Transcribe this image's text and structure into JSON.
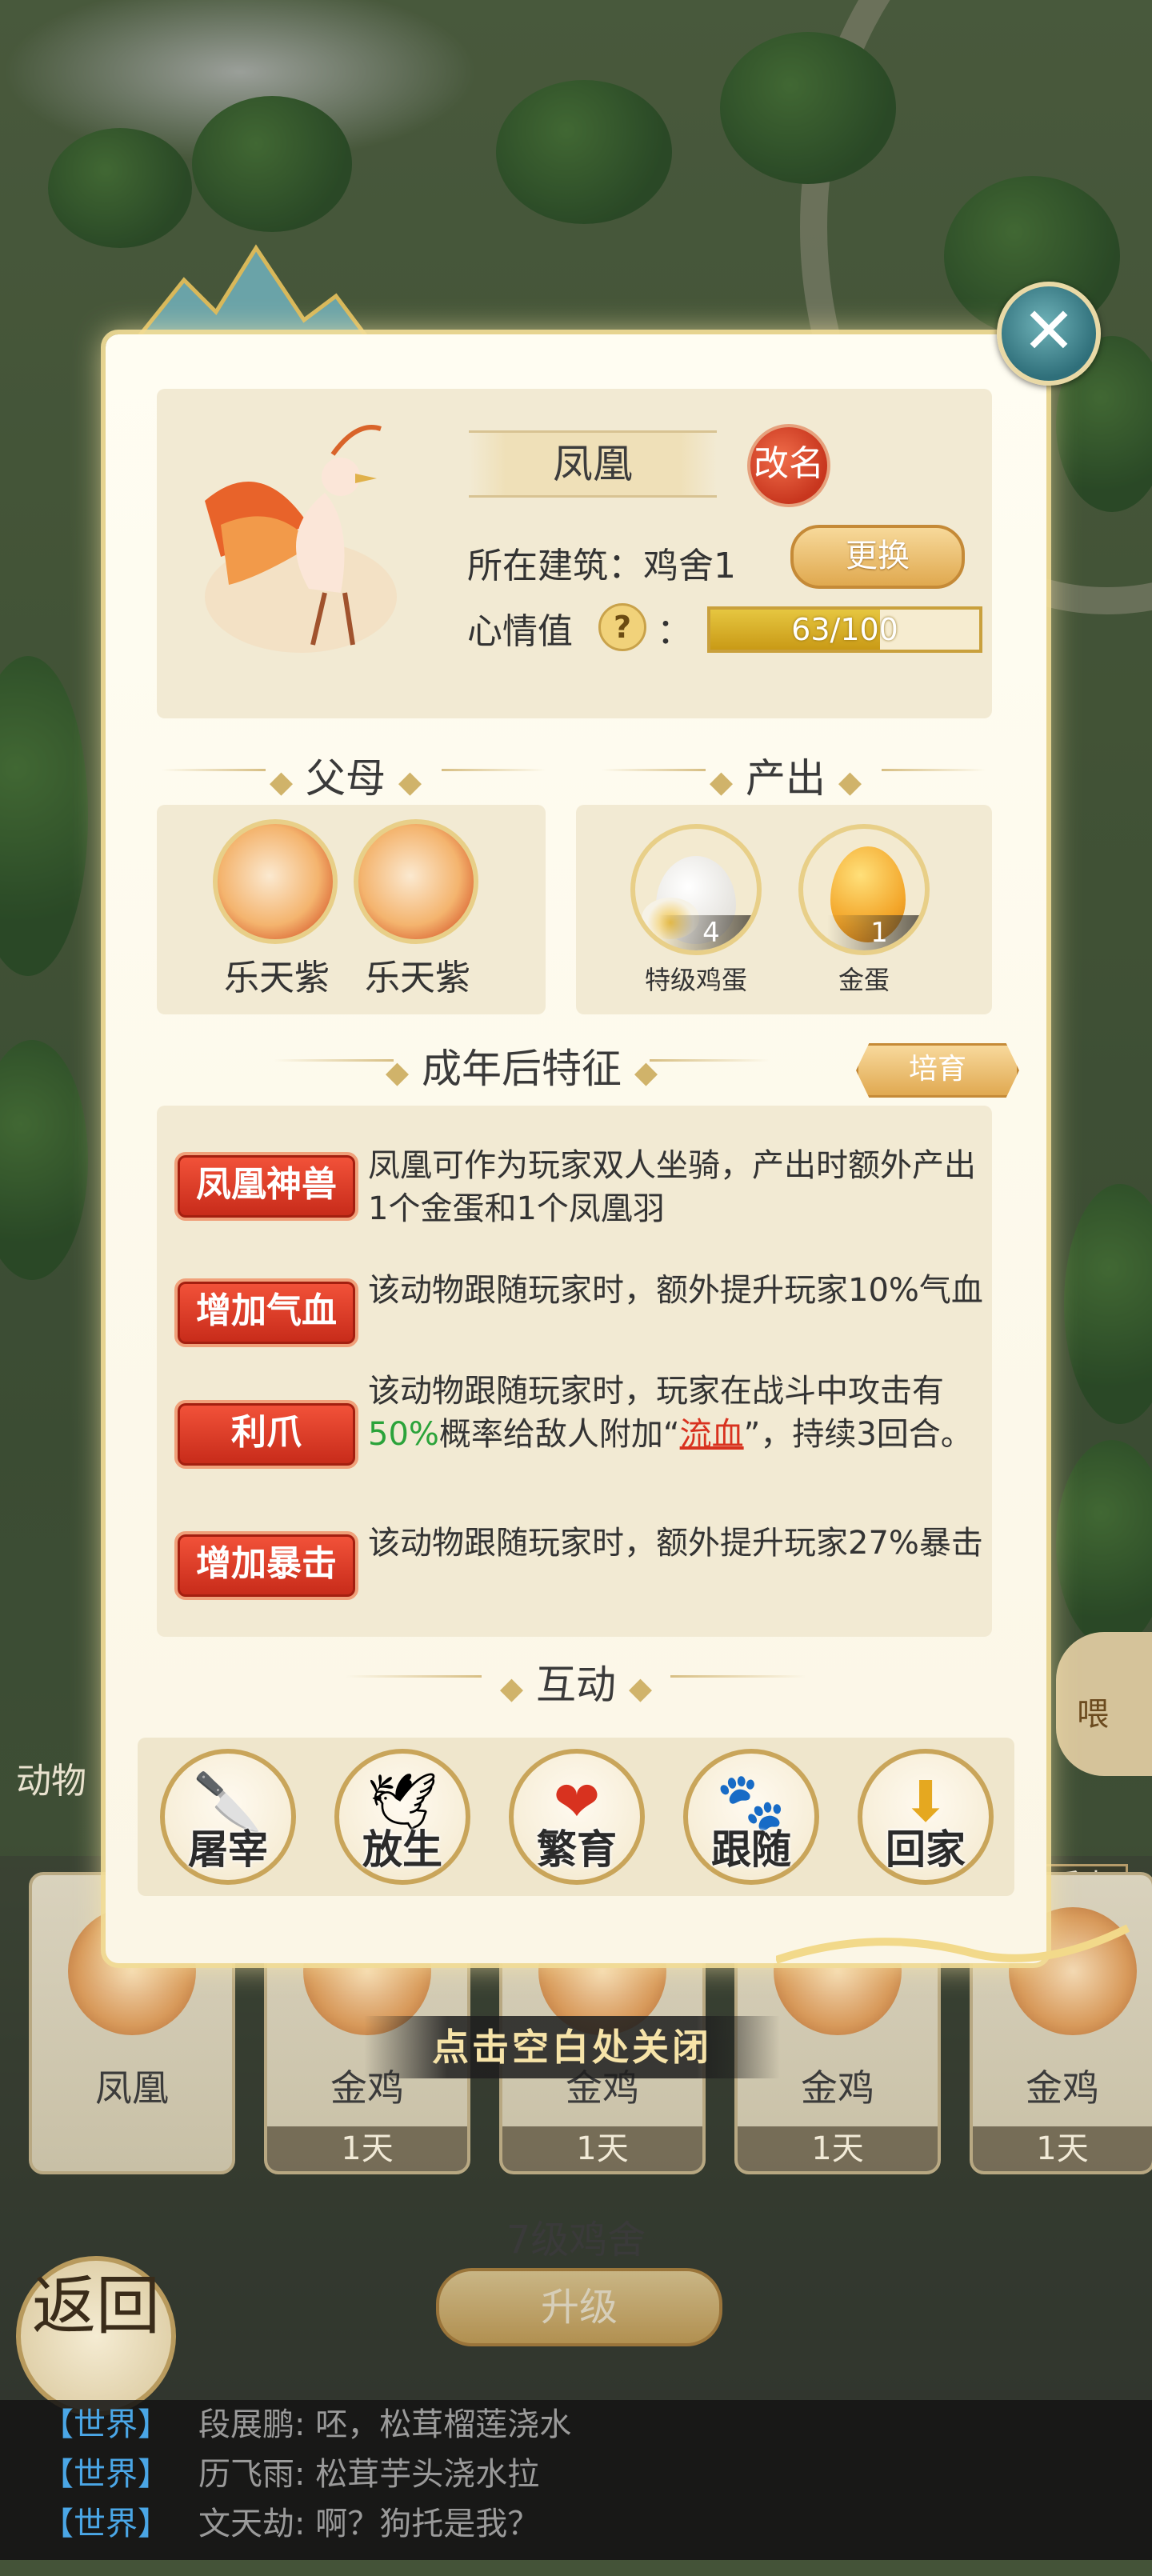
{
  "background": {
    "animal_tab": "动物",
    "feed_button": "喂",
    "pen_status": "系中",
    "animal_cards": [
      {
        "name": "凤凰",
        "time": ""
      },
      {
        "name": "金鸡",
        "time": "1天"
      },
      {
        "name": "金鸡",
        "time": "1天"
      },
      {
        "name": "金鸡",
        "time": "1天"
      },
      {
        "name": "金鸡",
        "time": "1天"
      }
    ],
    "close_hint": "点击空白处关闭",
    "coop_level": "7级鸡舍",
    "upgrade_label": "升级",
    "back_label": "返回"
  },
  "chat": [
    {
      "channel": "【世界】",
      "user": "段展鹏",
      "message": "呸，松茸榴莲浇水"
    },
    {
      "channel": "【世界】",
      "user": "历飞雨",
      "message": "松茸芋头浇水拉"
    },
    {
      "channel": "【世界】",
      "user": "文天劫",
      "message": "啊？狗托是我？"
    }
  ],
  "pet": {
    "name": "凤凰",
    "rename_label": "改名",
    "building_label": "所在建筑：鸡舍1",
    "change_label": "更换",
    "mood_label": "心情值",
    "mood_help": "?",
    "mood_colon": "：",
    "mood_text": "63/100",
    "mood_value": 63,
    "mood_max": 100
  },
  "sections": {
    "parents": "父母",
    "output": "产出",
    "traits": "成年后特征",
    "interact": "互动"
  },
  "parents": [
    "乐天紫",
    "乐天紫"
  ],
  "outputs": [
    {
      "name": "特级鸡蛋",
      "count": "4",
      "icon": "white-egg-icon"
    },
    {
      "name": "金蛋",
      "count": "1",
      "icon": "golden-egg-icon"
    }
  ],
  "breed_label": "培育",
  "traits": [
    {
      "badge": "凤凰神兽",
      "desc_parts": [
        "凤凰可作为玩家双人坐骑，产出时额外产出1个金蛋和1个凤凰羽"
      ]
    },
    {
      "badge": "增加气血",
      "desc_parts": [
        "该动物跟随玩家时，额外提升玩家10%气血"
      ]
    },
    {
      "badge": "利爪",
      "desc_parts": [
        "该动物跟随玩家时，玩家在战斗中攻击有",
        "50%",
        "概率给敌人附加“",
        "流血",
        "”，持续3回合。"
      ]
    },
    {
      "badge": "增加暴击",
      "desc_parts": [
        "该动物跟随玩家时，额外提升玩家27%暴击"
      ]
    }
  ],
  "actions": [
    {
      "label": "屠宰",
      "icon": "cleaver-icon",
      "glyph": "🔪"
    },
    {
      "label": "放生",
      "icon": "flying-bird-icon",
      "glyph": "🕊"
    },
    {
      "label": "繁育",
      "icon": "hearts-icon",
      "glyph": "❤"
    },
    {
      "label": "跟随",
      "icon": "paw-prints-icon",
      "glyph": "🐾"
    },
    {
      "label": "回家",
      "icon": "home-arrow-icon",
      "glyph": "⬇"
    }
  ],
  "colors": {
    "accent_gold": "#d7be83",
    "badge_red": "#c62a19",
    "chat_channel": "#4aa6e6",
    "highlight_green": "#2ba33a"
  }
}
